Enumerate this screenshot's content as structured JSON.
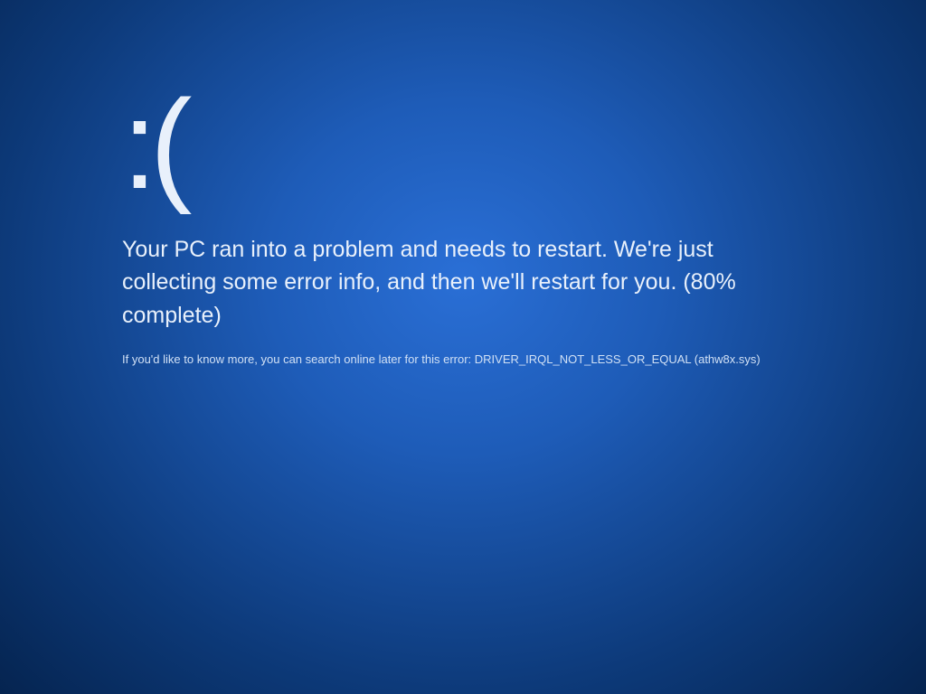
{
  "bsod": {
    "emoticon": ":(",
    "message": "Your PC ran into a problem and needs to restart. We're just collecting some error info, and then we'll restart for you. (80% complete)",
    "detail": "If you'd like to know more, you can search online later for this error: DRIVER_IRQL_NOT_LESS_OR_EQUAL (athw8x.sys)",
    "progress_percent": 80,
    "error_code": "DRIVER_IRQL_NOT_LESS_OR_EQUAL",
    "error_file": "athw8x.sys",
    "background_color": "#1e5cb8",
    "text_color": "#ffffff"
  }
}
